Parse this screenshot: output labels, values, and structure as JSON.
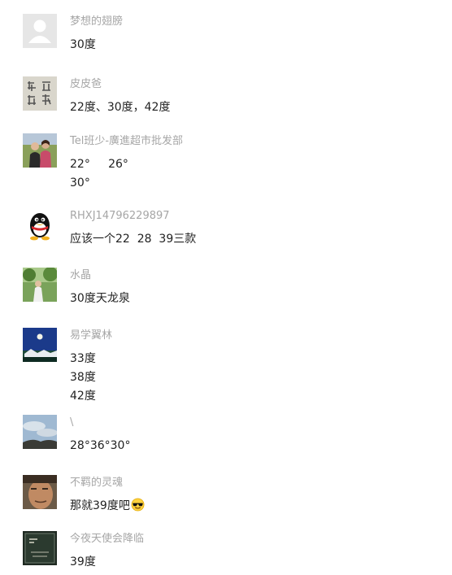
{
  "comments": [
    {
      "name": "梦想的翅膀",
      "avatar_icon": "default-user-avatar-icon",
      "lines": [
        "30度"
      ]
    },
    {
      "name": "皮皮爸",
      "avatar_icon": "calligraphy-avatar-icon",
      "lines": [
        "22度、30度，42度"
      ]
    },
    {
      "name": "Tel班少-廣進超市批发部",
      "avatar_icon": "couple-photo-avatar-icon",
      "lines": [
        "22°     26°",
        "30°"
      ]
    },
    {
      "name": "RHXJ14796229897",
      "avatar_icon": "qq-penguin-avatar-icon",
      "lines": [
        "应该一个22  28  39三款"
      ]
    },
    {
      "name": "水晶",
      "avatar_icon": "outdoor-portrait-avatar-icon",
      "lines": [
        "30度天龙泉"
      ]
    },
    {
      "name": "易学翼林",
      "avatar_icon": "night-moon-avatar-icon",
      "lines": [
        "33度",
        "38度",
        "42度"
      ]
    },
    {
      "name": "\\",
      "avatar_icon": "sky-landscape-avatar-icon",
      "lines": [
        "28°36°30°"
      ]
    },
    {
      "name": "不羁的灵魂",
      "avatar_icon": "face-closeup-avatar-icon",
      "lines": [
        "那就39度吧"
      ],
      "emoji": "sunglasses-emoji-icon"
    },
    {
      "name": "今夜天使会降临",
      "avatar_icon": "dark-poster-avatar-icon",
      "lines": [
        "39度"
      ]
    }
  ]
}
